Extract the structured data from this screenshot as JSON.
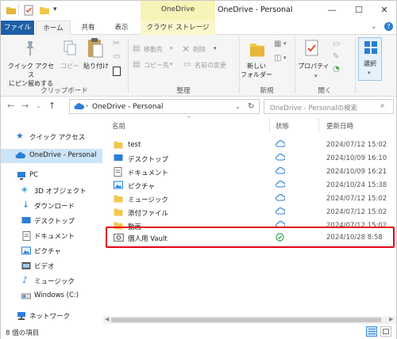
{
  "window": {
    "title": "OneDrive - Personal",
    "context_tab_group": "OneDrive",
    "controls": {
      "minimize": "—",
      "maximize": "☐",
      "close": "✕"
    }
  },
  "ribbon_tabs": [
    "ファイル",
    "ホーム",
    "共有",
    "表示",
    "クラウド ストレージ"
  ],
  "ribbon": {
    "clipboard": {
      "pin_label": "クイック アクセス\nにピン留めする",
      "copy_label": "コピー",
      "paste_label": "貼り付け",
      "group_label": "クリップボード"
    },
    "organize": {
      "move_label": "移動先",
      "copy_to_label": "コピー先",
      "delete_label": "削除",
      "rename_label": "名前の変更",
      "group_label": "整理"
    },
    "new": {
      "new_folder_label": "新しい\nフォルダー",
      "group_label": "新規"
    },
    "open": {
      "properties_label": "プロパティ",
      "group_label": "開く"
    },
    "select": {
      "select_label": "選択"
    }
  },
  "address_bar": {
    "path": "OneDrive - Personal",
    "search_placeholder": "OneDrive - Personalの検索"
  },
  "nav_pane": {
    "items": [
      {
        "label": "クイック アクセス",
        "icon": "star-icon"
      },
      {
        "label": "OneDrive - Personal",
        "icon": "cloud-icon"
      },
      {
        "label": "PC",
        "icon": "pc-icon"
      },
      {
        "label": "3D オブジェクト",
        "icon": "cube-icon"
      },
      {
        "label": "ダウンロード",
        "icon": "download-icon"
      },
      {
        "label": "デスクトップ",
        "icon": "desktop-icon"
      },
      {
        "label": "ドキュメント",
        "icon": "document-icon"
      },
      {
        "label": "ピクチャ",
        "icon": "picture-icon"
      },
      {
        "label": "ビデオ",
        "icon": "video-icon"
      },
      {
        "label": "ミュージック",
        "icon": "music-icon"
      },
      {
        "label": "Windows (C:)",
        "icon": "drive-icon"
      },
      {
        "label": "ネットワーク",
        "icon": "network-icon"
      }
    ]
  },
  "file_list": {
    "columns": {
      "name": "名前",
      "status": "状態",
      "modified": "更新日時"
    },
    "rows": [
      {
        "name": "test",
        "icon": "folder-icon",
        "status": "cloud",
        "modified": "2024/07/12 15:02"
      },
      {
        "name": "デスクトップ",
        "icon": "desktop-icon",
        "status": "cloud",
        "modified": "2024/10/09 16:10"
      },
      {
        "name": "ドキュメント",
        "icon": "document-icon",
        "status": "cloud",
        "modified": "2024/10/09 16:21"
      },
      {
        "name": "ピクチャ",
        "icon": "picture-icon",
        "status": "cloud",
        "modified": "2024/10/24 15:38"
      },
      {
        "name": "ミュージック",
        "icon": "folder-icon",
        "status": "cloud",
        "modified": "2024/07/12 15:02"
      },
      {
        "name": "添付ファイル",
        "icon": "folder-icon",
        "status": "cloud",
        "modified": "2024/07/12 15:02"
      },
      {
        "name": "動画",
        "icon": "folder-icon",
        "status": "cloud",
        "modified": "2024/07/12 15:02"
      },
      {
        "name": "個人用 Vault",
        "icon": "vault-icon",
        "status": "synced",
        "modified": "2024/10/28 8:58"
      }
    ]
  },
  "status_bar": {
    "item_count": "8 個の項目"
  },
  "colors": {
    "accent": "#1f5fa8",
    "selection": "#cce4f7",
    "context_tab": "#f8f3b8",
    "highlight_box": "#e8001c",
    "cloud": "#2b7fd6",
    "synced": "#1e9e3e",
    "folder": "#f2c74d"
  }
}
